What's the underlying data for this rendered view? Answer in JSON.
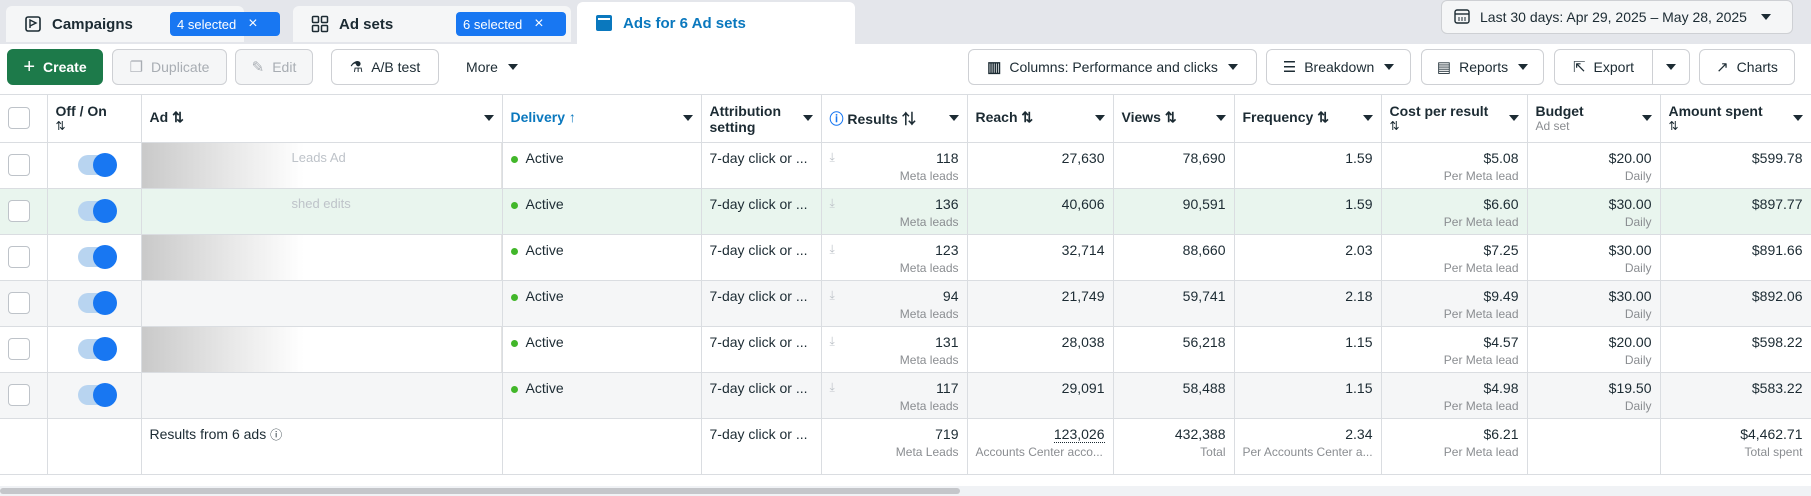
{
  "tabs": [
    {
      "label": "Campaigns",
      "badge": "4 selected",
      "icon": "campaign-flag-icon"
    },
    {
      "label": "Ad sets",
      "badge": "6 selected",
      "icon": "grid-icon"
    },
    {
      "label": "Ads for 6 Ad sets",
      "icon": "ad-window-icon"
    }
  ],
  "date_range": "Last 30 days: Apr 29, 2025 – May 28, 2025",
  "toolbar": {
    "create": "Create",
    "duplicate": "Duplicate",
    "edit": "Edit",
    "ab_test": "A/B test",
    "more": "More",
    "columns": "Columns: Performance and clicks",
    "breakdown": "Breakdown",
    "reports": "Reports",
    "export": "Export",
    "charts": "Charts"
  },
  "headers": {
    "offon": "Off / On",
    "ad": "Ad",
    "delivery": "Delivery",
    "attribution": "Attribution setting",
    "results": "Results",
    "reach": "Reach",
    "views": "Views",
    "frequency": "Frequency",
    "cpr": "Cost per result",
    "budget": "Budget",
    "budget_sub": "Ad set",
    "spent": "Amount spent"
  },
  "rows": [
    {
      "ad": "Leads Ad",
      "delivery": "Active",
      "attribution": "7-day click or ...",
      "results": "118",
      "results_unit": "Meta leads",
      "reach": "27,630",
      "views": "78,690",
      "frequency": "1.59",
      "cpr": "$5.08",
      "cpr_unit": "Per Meta lead",
      "budget": "$20.00",
      "budget_unit": "Daily",
      "spent": "$599.78"
    },
    {
      "ad": "shed edits",
      "delivery": "Active",
      "attribution": "7-day click or ...",
      "results": "136",
      "results_unit": "Meta leads",
      "reach": "40,606",
      "views": "90,591",
      "frequency": "1.59",
      "cpr": "$6.60",
      "cpr_unit": "Per Meta lead",
      "budget": "$30.00",
      "budget_unit": "Daily",
      "spent": "$897.77"
    },
    {
      "ad": "",
      "delivery": "Active",
      "attribution": "7-day click or ...",
      "results": "123",
      "results_unit": "Meta leads",
      "reach": "32,714",
      "views": "88,660",
      "frequency": "2.03",
      "cpr": "$7.25",
      "cpr_unit": "Per Meta lead",
      "budget": "$30.00",
      "budget_unit": "Daily",
      "spent": "$891.66"
    },
    {
      "ad": "",
      "delivery": "Active",
      "attribution": "7-day click or ...",
      "results": "94",
      "results_unit": "Meta leads",
      "reach": "21,749",
      "views": "59,741",
      "frequency": "2.18",
      "cpr": "$9.49",
      "cpr_unit": "Per Meta lead",
      "budget": "$30.00",
      "budget_unit": "Daily",
      "spent": "$892.06"
    },
    {
      "ad": "",
      "delivery": "Active",
      "attribution": "7-day click or ...",
      "results": "131",
      "results_unit": "Meta leads",
      "reach": "28,038",
      "views": "56,218",
      "frequency": "1.15",
      "cpr": "$4.57",
      "cpr_unit": "Per Meta lead",
      "budget": "$20.00",
      "budget_unit": "Daily",
      "spent": "$598.22"
    },
    {
      "ad": "",
      "delivery": "Active",
      "attribution": "7-day click or ...",
      "results": "117",
      "results_unit": "Meta leads",
      "reach": "29,091",
      "views": "58,488",
      "frequency": "1.15",
      "cpr": "$4.98",
      "cpr_unit": "Per Meta lead",
      "budget": "$19.50",
      "budget_unit": "Daily",
      "spent": "$583.22"
    }
  ],
  "footer": {
    "label": "Results from 6 ads",
    "attribution": "7-day click or ...",
    "results": "719",
    "results_unit": "Meta Leads",
    "reach": "123,026",
    "reach_unit": "Accounts Center acco...",
    "views": "432,388",
    "views_unit": "Total",
    "frequency": "2.34",
    "frequency_unit": "Per Accounts Center a...",
    "cpr": "$6.21",
    "cpr_unit": "Per Meta lead",
    "spent": "$4,462.71",
    "spent_unit": "Total spent"
  },
  "colors": {
    "primary_green": "#1d7a4a",
    "accent_blue": "#1877f2",
    "active_dot": "#42b72a"
  }
}
